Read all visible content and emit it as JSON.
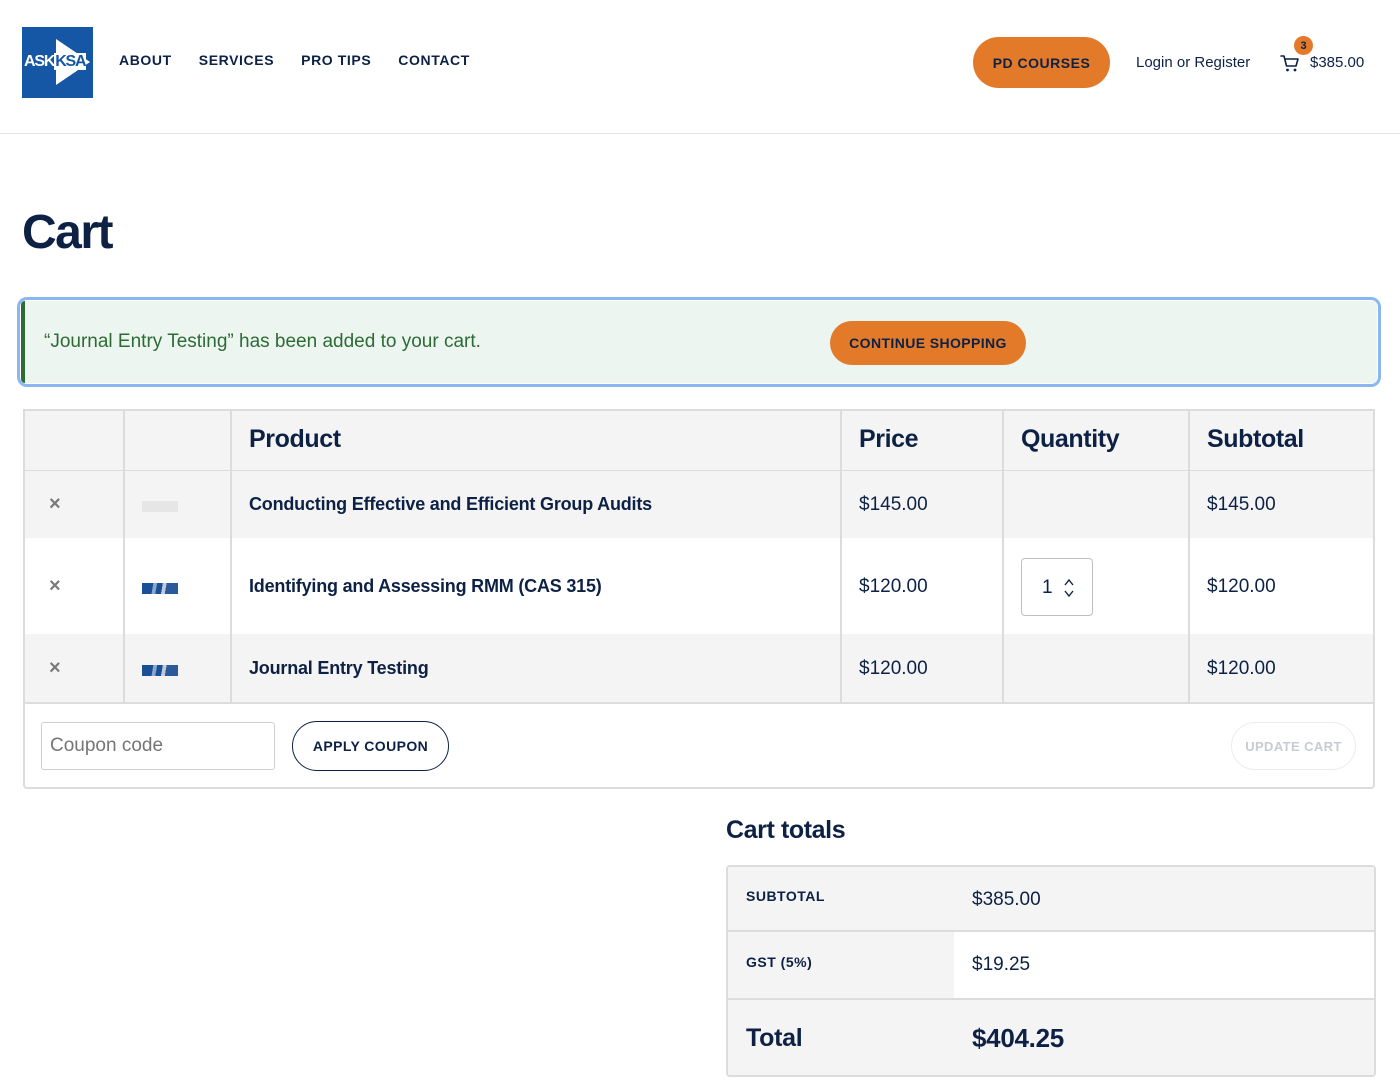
{
  "header": {
    "logo": {
      "left_text": "ASK",
      "right_text": "KSA"
    },
    "nav": [
      "ABOUT",
      "SERVICES",
      "PRO TIPS",
      "CONTACT"
    ],
    "pd_courses_label": "PD COURSES",
    "login_label": "Login or Register",
    "cart_count": "3",
    "cart_total": "$385.00"
  },
  "page": {
    "title": "Cart"
  },
  "notice": {
    "message": "“Journal Entry Testing” has been added to your cart.",
    "button_label": "CONTINUE SHOPPING"
  },
  "cart_table": {
    "columns": [
      "Product",
      "Price",
      "Quantity",
      "Subtotal"
    ],
    "rows": [
      {
        "remove": "×",
        "thumbnail": "blank",
        "product": "Conducting Effective and Efficient Group Audits",
        "price": "$145.00",
        "quantity": "",
        "subtotal": "$145.00"
      },
      {
        "remove": "×",
        "thumbnail": "course-image",
        "product": "Identifying and Assessing RMM (CAS 315)",
        "price": "$120.00",
        "quantity": "1",
        "subtotal": "$120.00"
      },
      {
        "remove": "×",
        "thumbnail": "course-image",
        "product": "Journal Entry Testing",
        "price": "$120.00",
        "quantity": "",
        "subtotal": "$120.00"
      }
    ],
    "coupon_placeholder": "Coupon code",
    "apply_coupon_label": "APPLY COUPON",
    "update_cart_label": "UPDATE CART"
  },
  "totals": {
    "title": "Cart totals",
    "rows": [
      {
        "label": "SUBTOTAL",
        "value": "$385.00"
      },
      {
        "label": "GST (5%)",
        "value": "$19.25"
      },
      {
        "label": "Total",
        "value": "$404.25"
      }
    ]
  },
  "colors": {
    "navy": "#0d2145",
    "brand_blue": "#1657a5",
    "accent_orange": "#e27a2a",
    "notice_green": "#2d6b36",
    "notice_bg": "#ecf5ef"
  },
  "icons": [
    "cart-icon",
    "close-icon",
    "spinner-arrows-icon"
  ]
}
